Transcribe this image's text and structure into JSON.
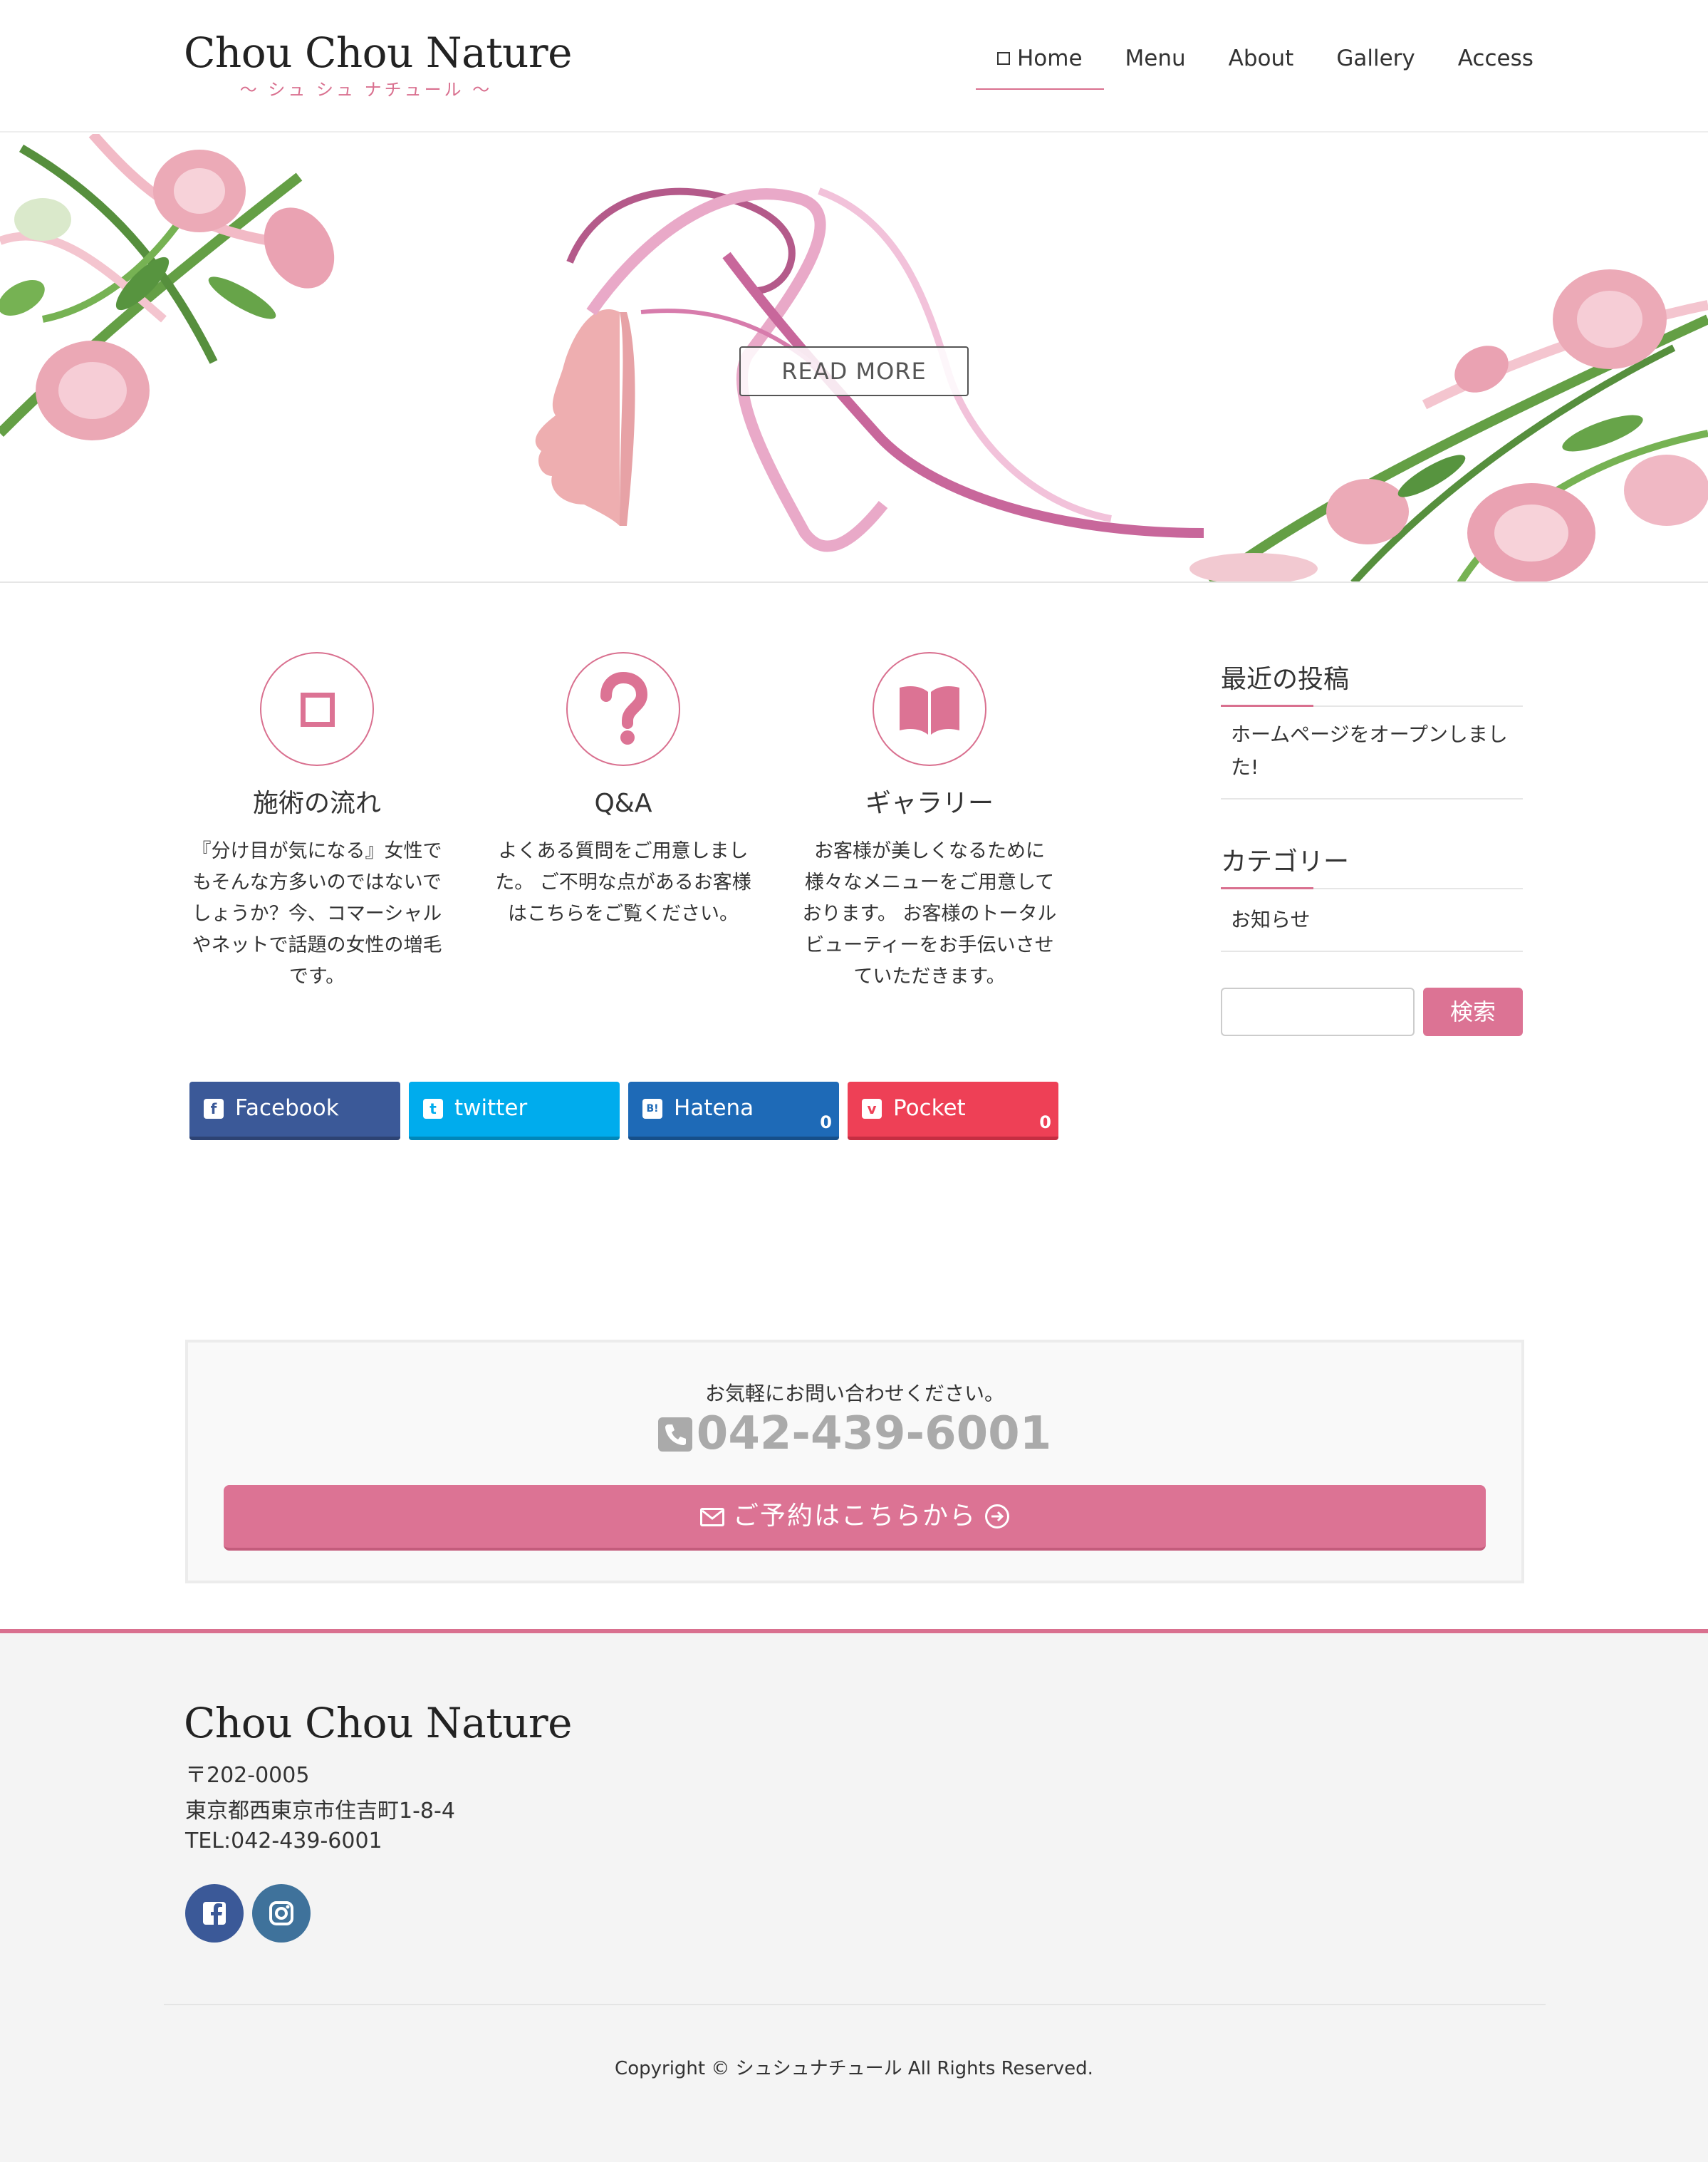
{
  "header": {
    "logo_title": "Chou Chou Nature",
    "logo_subtitle": "〜 シュ シュ ナチュール 〜",
    "nav": [
      {
        "label": "Home",
        "active": true
      },
      {
        "label": "Menu",
        "active": false
      },
      {
        "label": "About",
        "active": false
      },
      {
        "label": "Gallery",
        "active": false
      },
      {
        "label": "Access",
        "active": false
      }
    ]
  },
  "hero": {
    "button_label": "READ MORE"
  },
  "features": [
    {
      "icon": "square-icon",
      "title": "施術の流れ",
      "text": "『分け目が気になる』女性でもそんな方多いのではないでしょうか？今、コマーシャルやネットで話題の女性の増毛です。"
    },
    {
      "icon": "question-icon",
      "title": "Q&A",
      "text": "よくある質問をご用意しました。 ご不明な点があるお客様はこちらをご覧ください。"
    },
    {
      "icon": "book-icon",
      "title": "ギャラリー",
      "text": "お客様が美しくなるために様々なメニューをご用意しております。 お客様のトータルビューティーをお手伝いさせていただきます。"
    }
  ],
  "share": [
    {
      "label": "Facebook",
      "icon": "facebook-icon",
      "color": "#3b5998"
    },
    {
      "label": "twitter",
      "icon": "twitter-icon",
      "color": "#00aced"
    },
    {
      "label": "Hatena",
      "icon": "hatena-icon",
      "color": "#1e6ab7",
      "count": "0"
    },
    {
      "label": "Pocket",
      "icon": "pocket-icon",
      "color": "#ee4056",
      "count": "0"
    }
  ],
  "sidebar": {
    "recent_title": "最近の投稿",
    "recent_posts": [
      "ホームページをオープンしました!"
    ],
    "category_title": "カテゴリー",
    "categories": [
      "お知らせ"
    ],
    "search_placeholder": "",
    "search_button": "検索"
  },
  "contact": {
    "lead": "お気軽にお問い合わせください。",
    "phone": "042-439-6001",
    "button_label": "ご予約はこちらから"
  },
  "footer": {
    "logo_title": "Chou Chou Nature",
    "postal": "〒202-0005",
    "address": "東京都西東京市住吉町1-8-4",
    "tel": "TEL:042-439-6001",
    "social": [
      {
        "icon": "facebook-icon",
        "color": "#3b5998"
      },
      {
        "icon": "instagram-icon",
        "color": "#3f729b"
      }
    ],
    "copyright": "Copyright © シュシュナチュール All Rights Reserved."
  },
  "colors": {
    "accent": "#dc7394",
    "footer_bg": "#f4f4f4"
  }
}
